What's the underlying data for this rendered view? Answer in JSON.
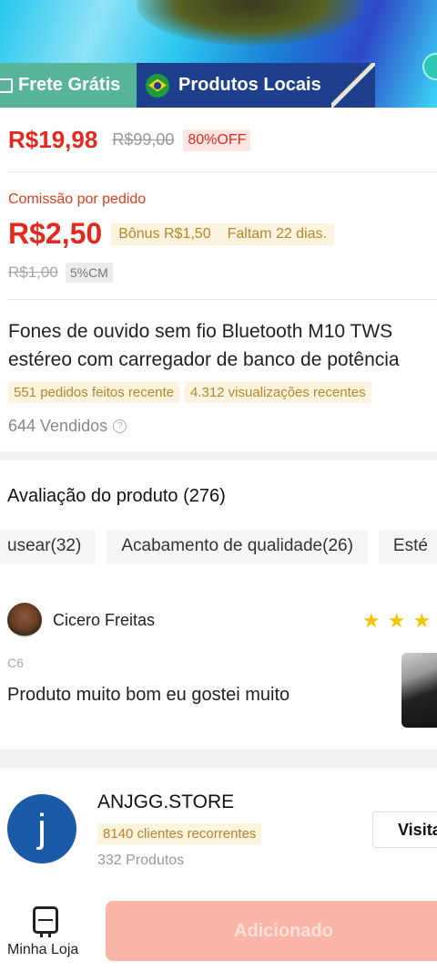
{
  "hero": {
    "badge_frete": "Frete Grátis",
    "badge_locais": "Produtos Locais"
  },
  "price": {
    "current": "R$19,98",
    "original": "R$99,00",
    "discount": "80%OFF"
  },
  "commission": {
    "label": "Comissão por pedido",
    "value": "R$2,50",
    "bonus": "Bônus R$1,50",
    "remaining": "Faltam 22 dias.",
    "old_value": "R$1,00",
    "cm": "5%CM"
  },
  "product": {
    "title": "Fones de ouvido sem fio Bluetooth M10 TWS estéreo com carregador de banco de potência",
    "orders_recent": "551 pedidos feitos recente",
    "views_recent": "4.312 visualizações recentes",
    "sold": "644 Vendidos"
  },
  "reviews": {
    "title": "Avaliação do produto (276)",
    "tags": [
      "usear(32)",
      "Acabamento de qualidade(26)",
      "Esté"
    ],
    "reviewer_name": "Cicero Freitas",
    "variant": "C6",
    "text": "Produto muito bom eu gostei muito",
    "rating_visible": 3
  },
  "store": {
    "logo_letter": "j",
    "name": "ANJGG.STORE",
    "returning_customers": "8140 clientes recorrentes",
    "products": "332 Produtos",
    "visit_label": "Visitar"
  },
  "bottom": {
    "my_store_label": "Minha Loja",
    "add_label": "Adicionado"
  },
  "colors": {
    "price_red": "#e3281d",
    "accent_gold": "#b9852a",
    "button_disabled": "#f9b6a6",
    "frete_green": "#58b59b",
    "locais_navy": "#1e3f8c"
  }
}
